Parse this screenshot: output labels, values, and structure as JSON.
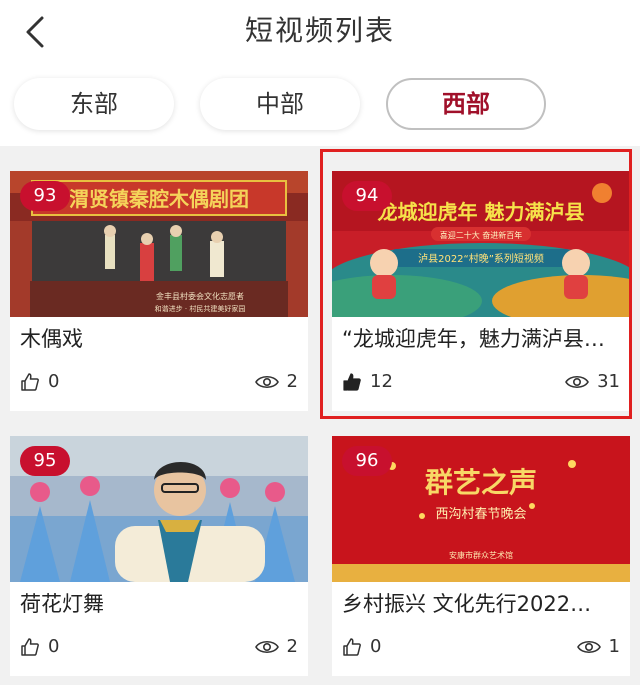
{
  "header": {
    "title": "短视频列表",
    "back_icon": "chevron-left-icon"
  },
  "tabs": [
    {
      "label": "东部",
      "active": false
    },
    {
      "label": "中部",
      "active": false
    },
    {
      "label": "西部",
      "active": true
    }
  ],
  "colors": {
    "accent": "#a0102a",
    "badge": "#c8102e",
    "highlight": "#e02020"
  },
  "videos": [
    {
      "rank": "93",
      "title": "木偶戏",
      "likes": "0",
      "views": "2",
      "liked": false,
      "banner_text": "渭贤镇秦腔木偶剧团",
      "caption1": "金丰县村委会文化志愿者",
      "caption2": "和谐进步 · 村民共建美好家园"
    },
    {
      "rank": "94",
      "title": "“龙城迎虎年，魅力满泸县…",
      "likes": "12",
      "views": "31",
      "liked": true,
      "banner_text": "龙城迎虎年  魅力满泸县",
      "subtitle": "喜迎二十大  奋进新百年",
      "series": "泸县2022“村晚”系列短视频"
    },
    {
      "rank": "95",
      "title": "荷花灯舞",
      "likes": "0",
      "views": "2",
      "liked": false
    },
    {
      "rank": "96",
      "title": "乡村振兴 文化先行2022…",
      "likes": "0",
      "views": "1",
      "liked": false,
      "banner_text": "群艺之声",
      "subtitle": "西沟村春节晚会",
      "footer": "安康市群众艺术馆"
    }
  ]
}
